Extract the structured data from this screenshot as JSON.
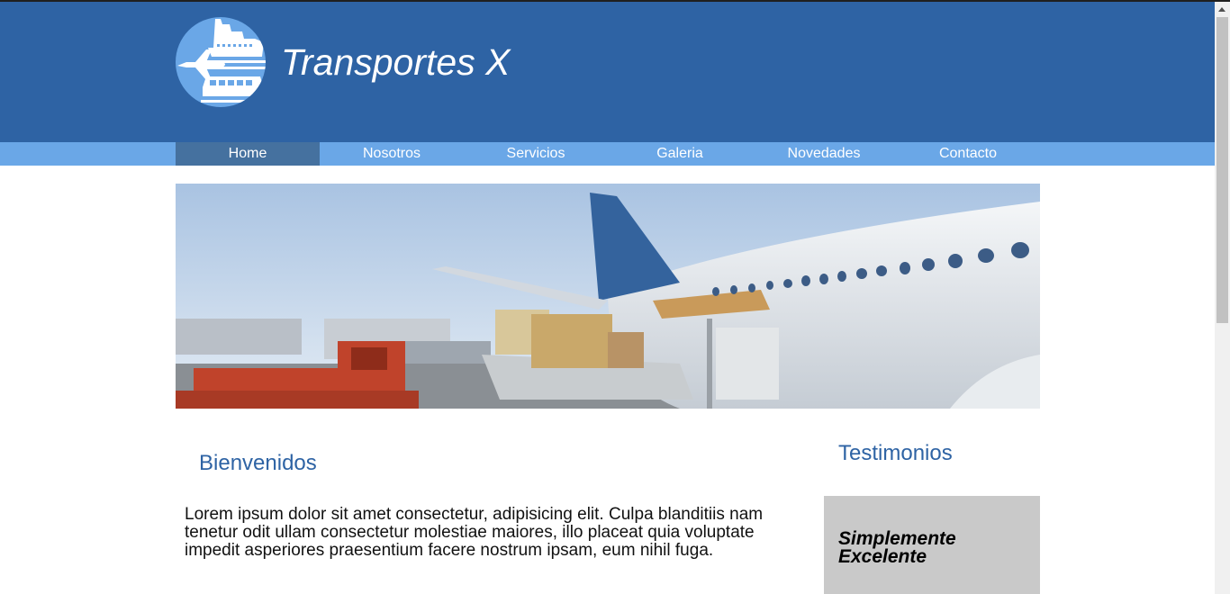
{
  "site": {
    "title": "Transportes X",
    "logo_icon": "transport-logo-icon"
  },
  "nav": {
    "items": [
      {
        "label": "Home",
        "active": true
      },
      {
        "label": "Nosotros"
      },
      {
        "label": "Servicios"
      },
      {
        "label": "Galeria"
      },
      {
        "label": "Novedades"
      },
      {
        "label": "Contacto"
      }
    ]
  },
  "main": {
    "heading": "Bienvenidos",
    "paragraph": "Lorem ipsum dolor sit amet consectetur, adipisicing elit. Culpa blanditiis nam tenetur odit ullam consectetur molestiae maiores, illo placeat quia voluptate impedit asperiores praesentium facere nostrum ipsam, eum nihil fuga."
  },
  "sidebar": {
    "heading": "Testimonios",
    "quote": "Simplemente Excelente"
  },
  "colors": {
    "header_bg": "#2e63a4",
    "nav_bg": "#6aa7e7",
    "nav_active_bg": "#45719f",
    "heading_text": "#2e63a4",
    "testimonial_bg": "#c9c9c9"
  }
}
